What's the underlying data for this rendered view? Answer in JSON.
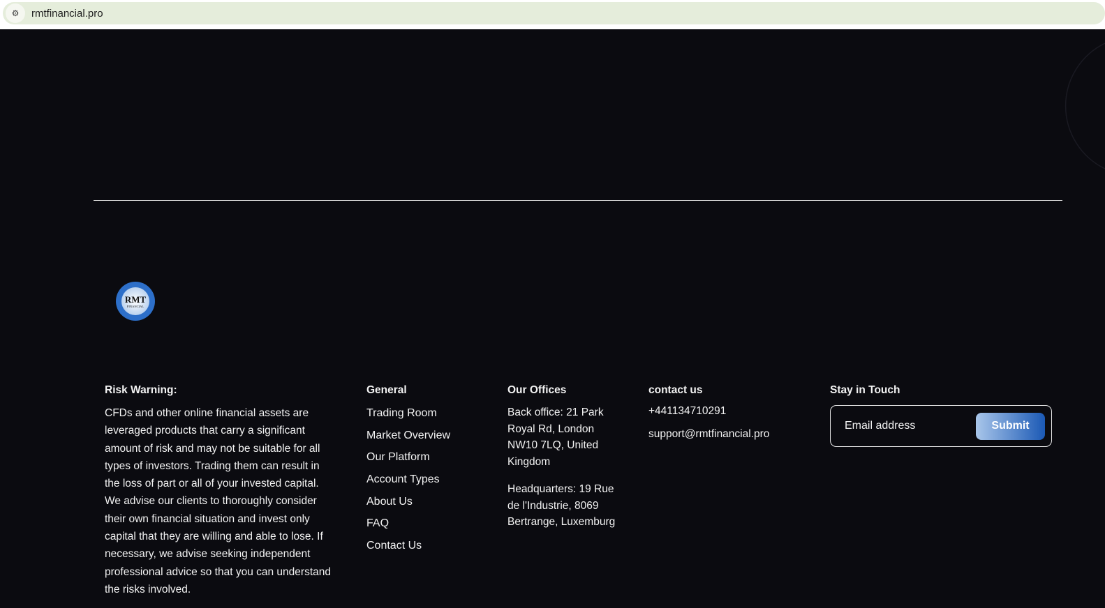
{
  "browser": {
    "url": "rmtfinancial.pro",
    "site_icon": "site-settings-icon"
  },
  "logo": {
    "line1": "RMT",
    "line2": "FINANCIAL"
  },
  "risk": {
    "title": "Risk Warning:",
    "text": "CFDs and other online financial assets are leveraged products that carry a significant amount of risk and may not be suitable for all types of investors. Trading them can result in the loss of part or all of your invested capital. We advise our clients to thoroughly consider their own financial situation and invest only capital that they are willing and able to lose. If necessary, we advise seeking independent professional advice so that you can understand the risks involved."
  },
  "general": {
    "title": "General",
    "links": [
      "Trading Room",
      "Market Overview",
      "Our Platform",
      "Account Types",
      "About Us",
      "FAQ",
      "Contact Us"
    ]
  },
  "offices": {
    "title": "Our Offices",
    "back": "Back office: 21 Park Royal Rd, London NW10 7LQ, United Kingdom",
    "hq": "Headquarters: 19 Rue de l'Industrie, 8069 Bertrange, Luxemburg"
  },
  "contact": {
    "title": "contact us",
    "phone": "+441134710291",
    "email": "support@rmtfinancial.pro"
  },
  "stay": {
    "title": "Stay in Touch",
    "placeholder": "Email address",
    "submit": "Submit"
  }
}
